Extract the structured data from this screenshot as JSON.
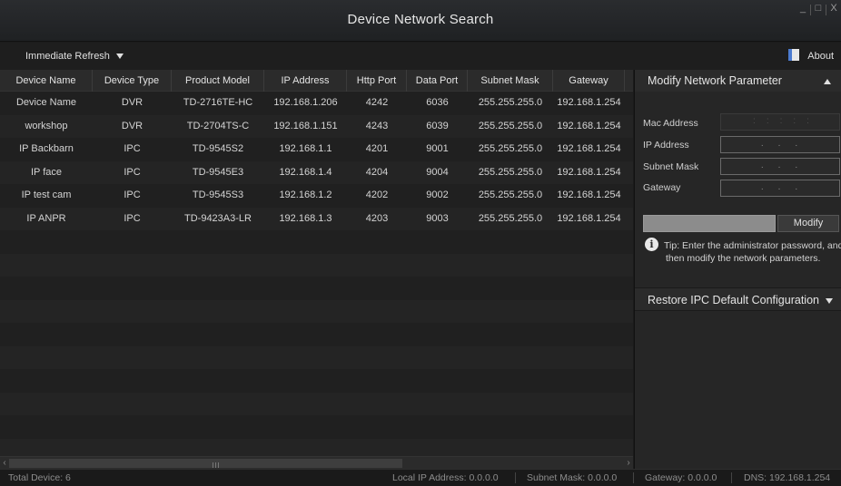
{
  "window": {
    "title": "Device Network Search",
    "controls": {
      "minimize": "_",
      "maximize": "□",
      "close": "X"
    }
  },
  "toolbar": {
    "refresh_label": "Immediate Refresh",
    "about_label": "About",
    "about_icon": "book-icon"
  },
  "table": {
    "columns": [
      "Device Name",
      "Device Type",
      "Product Model",
      "IP Address",
      "Http Port",
      "Data Port",
      "Subnet Mask",
      "Gateway"
    ],
    "rows": [
      [
        "Device Name",
        "DVR",
        "TD-2716TE-HC",
        "192.168.1.206",
        "4242",
        "6036",
        "255.255.255.0",
        "192.168.1.254"
      ],
      [
        "workshop",
        "DVR",
        "TD-2704TS-C",
        "192.168.1.151",
        "4243",
        "6039",
        "255.255.255.0",
        "192.168.1.254"
      ],
      [
        "IP Backbarn",
        "IPC",
        "TD-9545S2",
        "192.168.1.1",
        "4201",
        "9001",
        "255.255.255.0",
        "192.168.1.254"
      ],
      [
        "IP face",
        "IPC",
        "TD-9545E3",
        "192.168.1.4",
        "4204",
        "9004",
        "255.255.255.0",
        "192.168.1.254"
      ],
      [
        "IP test cam",
        "IPC",
        "TD-9545S3",
        "192.168.1.2",
        "4202",
        "9002",
        "255.255.255.0",
        "192.168.1.254"
      ],
      [
        "IP ANPR",
        "IPC",
        "TD-9423A3-LR",
        "192.168.1.3",
        "4203",
        "9003",
        "255.255.255.0",
        "192.168.1.254"
      ]
    ]
  },
  "panel": {
    "modify_title": "Modify Network Parameter",
    "fields": {
      "mac_label": "Mac Address",
      "mac_value": ":::::",
      "ip_label": "IP Address",
      "ip_value": "...",
      "subnet_label": "Subnet Mask",
      "subnet_value": "...",
      "gateway_label": "Gateway",
      "gateway_value": "..."
    },
    "modify_button": "Modify",
    "tip": "Tip: Enter the administrator password, and then modify the network parameters.",
    "tip_line1": "Tip: Enter the administrator password, and",
    "tip_line2": "then modify the network parameters.",
    "restore_title": "Restore IPC Default Configuration"
  },
  "status": {
    "total": "Total Device: 6",
    "local_ip": "Local IP Address: 0.0.0.0",
    "subnet": "Subnet Mask: 0.0.0.0",
    "gateway": "Gateway: 0.0.0.0",
    "dns": "DNS: 192.168.1.254"
  }
}
